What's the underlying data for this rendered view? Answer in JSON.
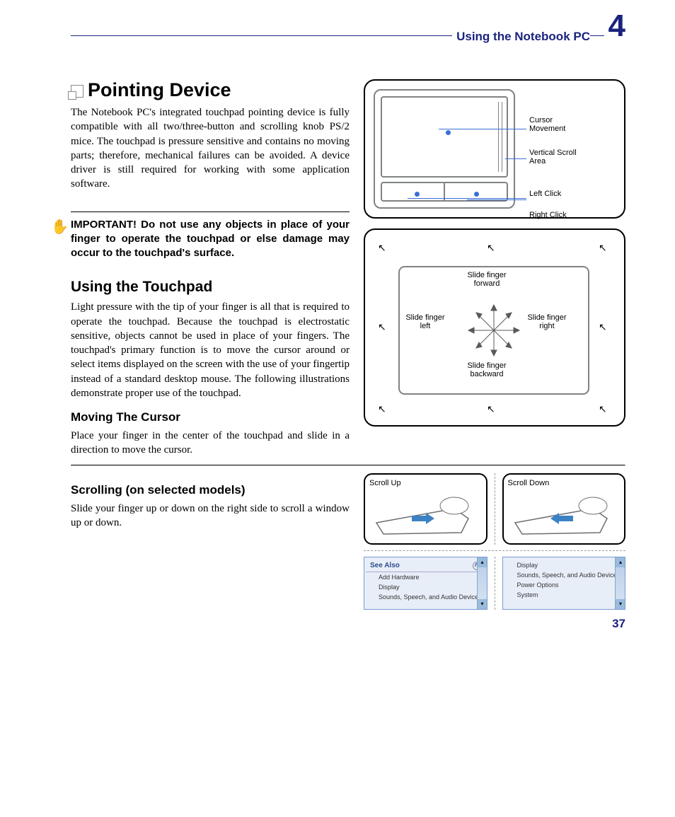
{
  "header": {
    "section": "Using the Notebook PC",
    "chapter": "4"
  },
  "h1": "Pointing Device",
  "intro": "The Notebook PC's integrated touchpad pointing device is fully compatible with all two/three-button and scrolling knob PS/2 mice. The touchpad is pressure sensitive and contains no moving parts; therefore, mechanical failures can be avoided. A device driver is still required for working with some application software.",
  "important": "IMPORTANT! Do not use any objects in place of your finger to operate the touchpad or else damage may occur to the touchpad's surface.",
  "h2": "Using the Touchpad",
  "touchpad_text": "Light pressure with the tip of your finger is all that is required to operate the touchpad. Because the touchpad is electrostatic sensitive, objects cannot be used in place of your fingers. The touchpad's primary function is to move the cursor around or select items displayed on the screen with the use of your fingertip instead of a standard desktop mouse. The following illustrations demonstrate proper use of the touchpad.",
  "h3a": "Moving The Cursor",
  "cursor_text": "Place your finger in the center of the touchpad and slide in a direction to move the cursor.",
  "h3b": "Scrolling (on selected models)",
  "scroll_text": "Slide your finger up or down on the right side to scroll a window up or down.",
  "labels": {
    "cursor_movement": "Cursor Movement",
    "vertical_scroll": "Vertical Scroll Area",
    "left_click": "Left Click",
    "right_click": "Right Click",
    "slide_forward": "Slide finger forward",
    "slide_backward": "Slide finger backward",
    "slide_left": "Slide finger left",
    "slide_right": "Slide finger right",
    "scroll_up": "Scroll Up",
    "scroll_down": "Scroll Down"
  },
  "screenshot": {
    "see_also": "See Also",
    "add_hardware": "Add Hardware",
    "display": "Display",
    "sounds": "Sounds, Speech, and Audio Devices",
    "power": "Power Options",
    "system": "System"
  },
  "page_number": "37"
}
